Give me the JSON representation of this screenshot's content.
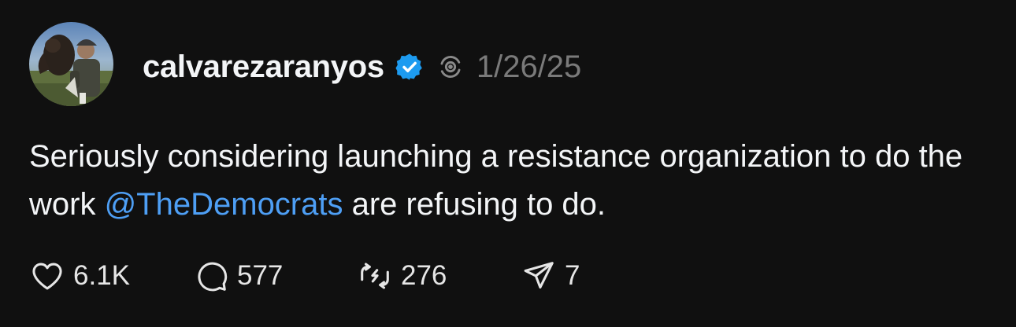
{
  "post": {
    "username": "calvarezaranyos",
    "date": "1/26/25",
    "text_before": "Seriously considering launching a resistance organization to do the work ",
    "mention": "@TheDemocrats",
    "text_after": " are refusing to do.",
    "likes": "6.1K",
    "replies": "577",
    "reposts": "276",
    "shares": "7"
  },
  "icons": {
    "verified": "verified-badge-icon",
    "fediverse": "fediverse-icon",
    "like": "heart-icon",
    "reply": "comment-icon",
    "repost": "repost-icon",
    "share": "share-icon"
  },
  "colors": {
    "background": "#101010",
    "text": "#f3f5f7",
    "muted": "#7a7a7a",
    "mention": "#4e9ff5",
    "verified": "#1d9bf0"
  }
}
